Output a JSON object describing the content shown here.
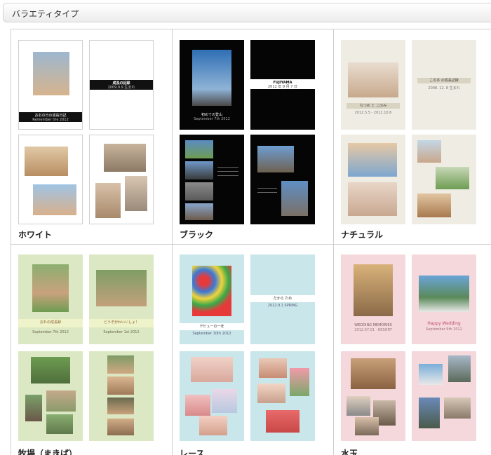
{
  "header": {
    "title": "バラエティタイプ"
  },
  "styles": [
    {
      "label": "ホワイト",
      "covers": {
        "left_title": "おおの日の成長日記",
        "left_sub": "Remember the 2012",
        "right_title": "成長の記録",
        "right_sub": "2009.9.9 生まれ"
      }
    },
    {
      "label": "ブラック",
      "covers": {
        "left_title": "初めての登山",
        "left_sub": "September 7th 2012",
        "right_title": "FUJIYAMA",
        "right_sub": "2012 年 9 月 7 日"
      }
    },
    {
      "label": "ナチュラル",
      "covers": {
        "left_title": "なつめ と このみ",
        "left_sub": "2012.5.5 - 2012.10.6",
        "right_title": "この本 の成長記録",
        "right_sub": "2008. 12. 8 生まれ"
      }
    },
    {
      "label": "牧場（まきば）",
      "covers": {
        "left_title": "おれの成長録",
        "left_sub": "September 7th 2012",
        "right_title": "どうぞがわいいしょ！",
        "right_sub": "September 1st 2012"
      }
    },
    {
      "label": "レース",
      "covers": {
        "left_title": "デビューの一年",
        "left_sub": "September 10th 2012",
        "right_title": "だから ため",
        "right_sub": "2012.9.1 SPRING"
      }
    },
    {
      "label": "水玉",
      "covers": {
        "left_title": "WEDDING MEMORIES",
        "left_sub": "2012.07.01 · RESORT",
        "right_title": "Happy Wedding",
        "right_sub": "September 9th 2012"
      }
    }
  ],
  "colors": {
    "photo_sky": "#4f86c6",
    "photo_skin": "#d9b08c",
    "photo_green": "#6e9c52",
    "photo_sepia": "#b9936a",
    "photo_gray": "#8f8f8f"
  }
}
